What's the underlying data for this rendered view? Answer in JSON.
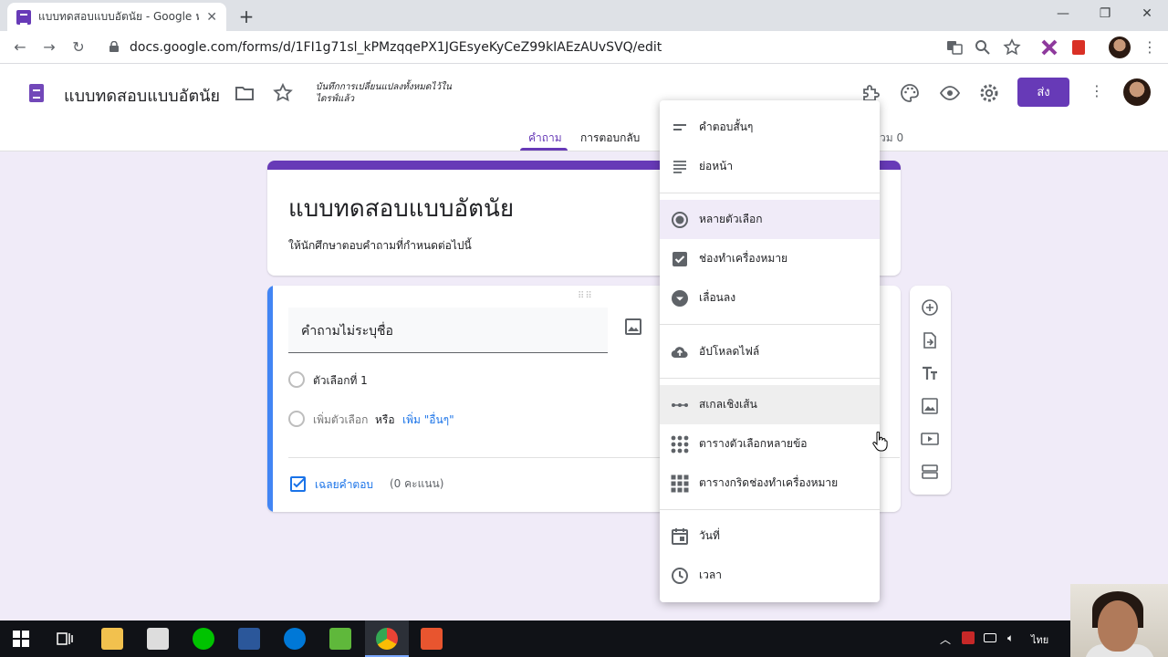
{
  "browser": {
    "tab_title": "แบบทดสอบแบบอัตนัย - Google ฟอร์ม",
    "url": "docs.google.com/forms/d/1FI1g71sl_kPMzqqePX1JGEsyeKyCeZ99kIAEzAUvSVQ/edit"
  },
  "header": {
    "doc_title": "แบบทดสอบแบบอัตนัย",
    "saved_note": "บันทึกการเปลี่ยนแปลงทั้งหมดไว้ในไดรฟ์แล้ว",
    "send_label": "ส่ง",
    "tabs": [
      {
        "label": "คำถาม"
      },
      {
        "label": "การตอบกลับ"
      }
    ],
    "total_label": "วม 0"
  },
  "form": {
    "title": "แบบทดสอบแบบอัตนัย",
    "description": "ให้นักศึกษาตอบคำถามที่กำหนดต่อไปนี้"
  },
  "question": {
    "text": "คำถามไม่ระบุชื่อ",
    "option1": "ตัวเลือกที่ 1",
    "add_option": "เพิ่มตัวเลือก",
    "or": "หรือ",
    "add_other": "เพิ่ม \"อื่นๆ\"",
    "answer_key": "เฉลยคำตอบ",
    "points": "(0 คะแนน)"
  },
  "menu": {
    "items": [
      {
        "label": "คำตอบสั้นๆ",
        "icon": "short-answer-icon"
      },
      {
        "label": "ย่อหน้า",
        "icon": "paragraph-icon"
      },
      {
        "label": "หลายตัวเลือก",
        "icon": "radio-icon"
      },
      {
        "label": "ช่องทำเครื่องหมาย",
        "icon": "checkbox-icon"
      },
      {
        "label": "เลื่อนลง",
        "icon": "dropdown-icon"
      },
      {
        "label": "อัปโหลดไฟล์",
        "icon": "cloud-upload-icon"
      },
      {
        "label": "สเกลเชิงเส้น",
        "icon": "linear-scale-icon"
      },
      {
        "label": "ตารางตัวเลือกหลายข้อ",
        "icon": "grid-icon"
      },
      {
        "label": "ตารางกริดช่องทำเครื่องหมาย",
        "icon": "checkbox-grid-icon"
      },
      {
        "label": "วันที่",
        "icon": "calendar-icon"
      },
      {
        "label": "เวลา",
        "icon": "clock-icon"
      }
    ]
  },
  "taskbar": {
    "language": "ไทย"
  },
  "colors": {
    "accent": "#673ab7",
    "background": "#f0ebf8",
    "link": "#1a73e8"
  }
}
